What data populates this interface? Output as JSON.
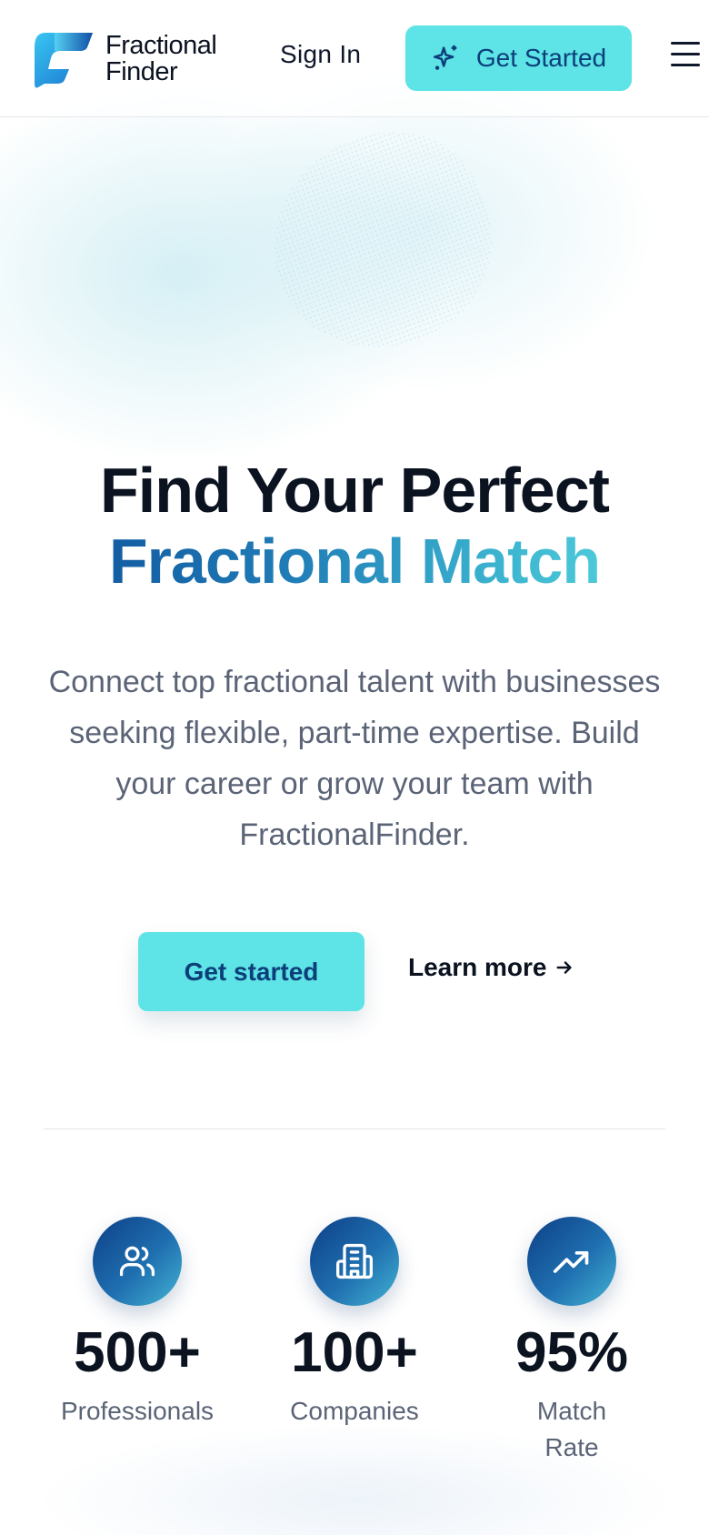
{
  "header": {
    "brand_line1": "Fractional",
    "brand_line2": "Finder",
    "sign_in": "Sign In",
    "get_started": "Get Started",
    "menu_icon": "hamburger-menu-icon",
    "cta_icon": "sparkles-icon"
  },
  "hero": {
    "title_line1": "Find Your Perfect",
    "title_line2": "Fractional Match",
    "subtitle": "Connect top fractional talent with businesses seeking flexible, part-time expertise. Build your career or grow your team with FractionalFinder.",
    "primary_button": "Get started",
    "secondary_button": "Learn more",
    "secondary_icon": "arrow-right-icon"
  },
  "stats": [
    {
      "icon": "users-icon",
      "value": "500+",
      "label": "Professionals"
    },
    {
      "icon": "building-icon",
      "value": "100+",
      "label": "Companies"
    },
    {
      "icon": "trending-up-icon",
      "value": "95%",
      "label": "Match Rate"
    }
  ],
  "colors": {
    "accent": "#5ee3e6",
    "accent_text": "#0c3f7a",
    "gradient_start": "#0d4a96",
    "gradient_end": "#5fe0e3",
    "muted_text": "#5b6477"
  }
}
